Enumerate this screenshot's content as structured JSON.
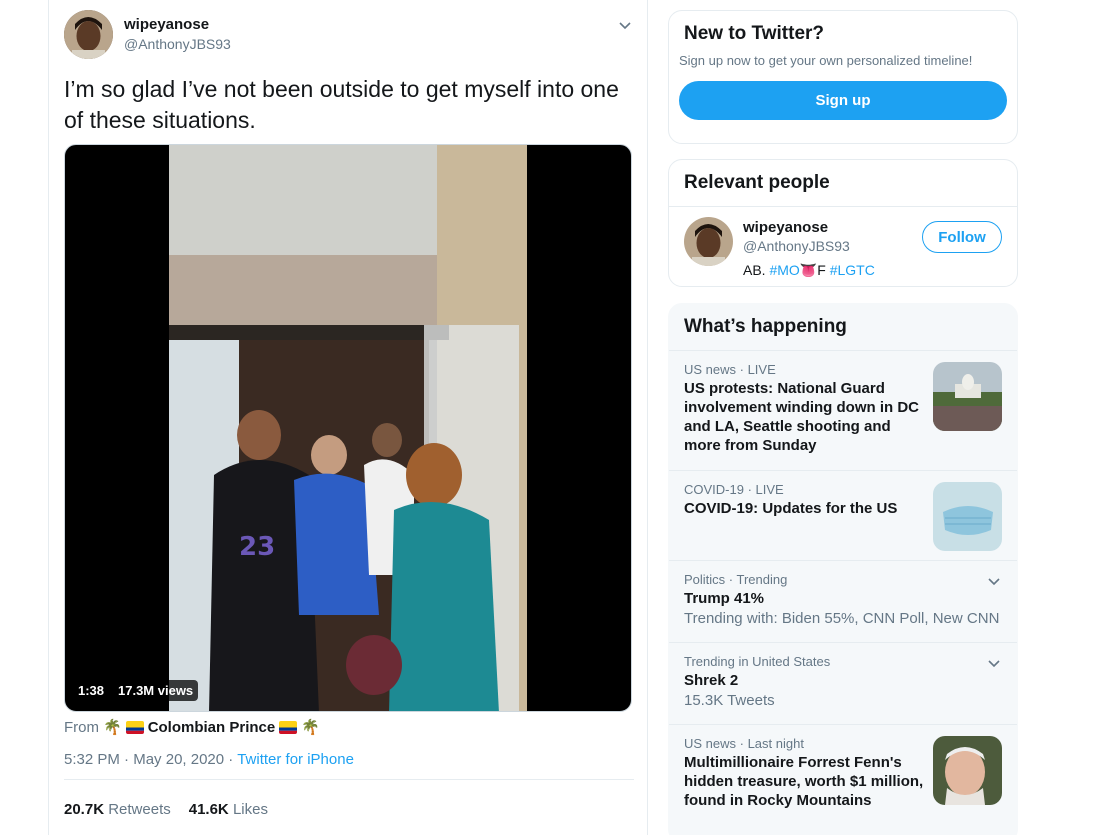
{
  "tweet": {
    "display_name": "wipeyanose",
    "handle": "@AnthonyJBS93",
    "text": "I’m so glad I’ve not been outside to get myself into one of these situations.",
    "video": {
      "duration": "1:38",
      "views": "17.3M views"
    },
    "source_prefix": "From",
    "source_name": "Colombian Prince",
    "source_emoji": "🌴",
    "time": "5:32 PM",
    "date": "May 20, 2020",
    "separator": "·",
    "client": "Twitter for iPhone",
    "retweets_count": "20.7K",
    "retweets_label": "Retweets",
    "likes_count": "41.6K",
    "likes_label": "Likes"
  },
  "signup": {
    "title": "New to Twitter?",
    "subtitle": "Sign up now to get your own personalized timeline!",
    "button": "Sign up"
  },
  "relevant_people": {
    "title": "Relevant people",
    "person": {
      "name": "wipeyanose",
      "handle": "@AnthonyJBS93",
      "bio_prefix": "AB.",
      "bio_tag1": "#MO",
      "bio_emoji": "👅",
      "bio_mid": "F",
      "bio_tag2": "#LGTC",
      "follow_label": "Follow"
    }
  },
  "whats_happening": {
    "title": "What’s happening",
    "items": [
      {
        "meta": "US news · LIVE",
        "title": "US protests: National Guard involvement winding down in DC and LA, Seattle shooting and more from Sunday"
      },
      {
        "meta": "COVID-19 · LIVE",
        "title": "COVID-19: Updates for the US"
      },
      {
        "meta": "Politics · Trending",
        "title": "Trump 41%",
        "sub": "Trending with: Biden 55%, CNN Poll, New CNN"
      },
      {
        "meta": "Trending in United States",
        "title": "Shrek 2",
        "sub": "15.3K Tweets"
      },
      {
        "meta": "US news · Last night",
        "title": "Multimillionaire Forrest Fenn's hidden treasure, worth $1 million, found in Rocky Mountains"
      }
    ]
  },
  "colors": {
    "accent": "#1da1f2",
    "text": "#14171a",
    "muted": "#657786",
    "border": "#e6ecf0",
    "panel_bg": "#f5f8fa"
  }
}
